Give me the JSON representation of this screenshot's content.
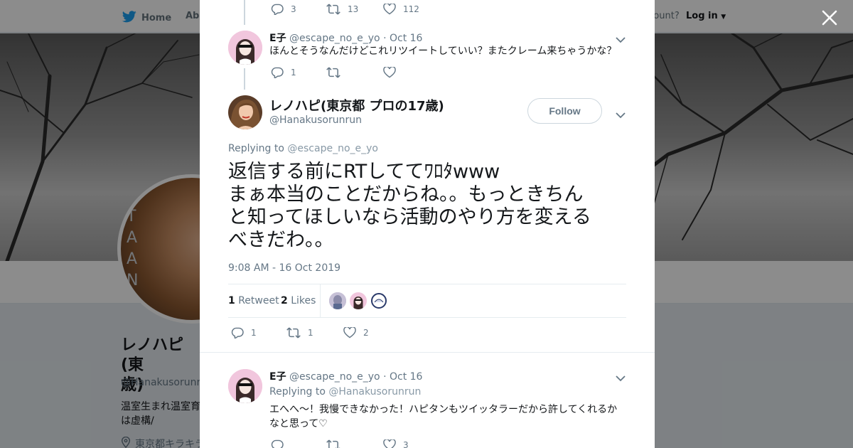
{
  "topbar": {
    "home_label": "Home",
    "about_label": "Abo",
    "account_prompt": "ccount?",
    "login_label": "Log in"
  },
  "profile": {
    "name": "レノハピ(東\n歳)",
    "handle": "@Hanakusorunru",
    "bio": "温室生まれ温室育\nは虚構/",
    "location": "東京都キラキラ",
    "avatar_sign_text": "T A\nA N"
  },
  "thread": {
    "parent": {
      "reply_count": "3",
      "retweet_count": "13",
      "like_count": "112"
    },
    "reply1": {
      "fullname": "E子",
      "handle": "@escape_no_e_yo",
      "separator": "·",
      "date": "Oct 16",
      "text": "ほんとそうなんだけどこれリツイートしていい？またクレーム来ちゃうかな？",
      "reply_count": "1",
      "retweet_count": "",
      "like_count": ""
    },
    "focus": {
      "fullname": "レノハピ(東京都 プロの17歳)",
      "handle": "@Hanakusorunrun",
      "follow_label": "Follow",
      "replying_prefix": "Replying to",
      "replying_to": "@escape_no_e_yo",
      "text": "返信する前にRTしててﾜﾛﾀwww\nまぁ本当のことだからね。。もっときちん\nと知ってほしいなら活動のやり方を変える\nべきだわ。。",
      "timestamp": "9:08 AM - 16 Oct 2019",
      "retweets_count": "1",
      "retweets_label": "Retweet",
      "likes_count": "2",
      "likes_label": "Likes",
      "reply_count": "1",
      "retweet_count": "1",
      "like_count": "2"
    },
    "reply2": {
      "fullname": "E子",
      "handle": "@escape_no_e_yo",
      "separator": "·",
      "date": "Oct 16",
      "replying_prefix": "Replying to",
      "replying_to": "@Hanakusorunrun",
      "text": "エへへ〜！我慢できなかった！ハピタンもツイッタラーだから許してくれるかなと思って♡",
      "reply_count": "",
      "retweet_count": "",
      "like_count": "3"
    }
  },
  "colors": {
    "twitter_blue": "#1da1f2",
    "text_primary": "#14171a",
    "text_secondary": "#657786",
    "divider": "#e6ecf0",
    "e_avatar_bg": "#f1c6dd"
  },
  "icons": [
    "twitter-bird-icon",
    "reply-icon",
    "retweet-icon",
    "like-icon",
    "chevron-down-icon",
    "close-icon",
    "location-icon"
  ]
}
